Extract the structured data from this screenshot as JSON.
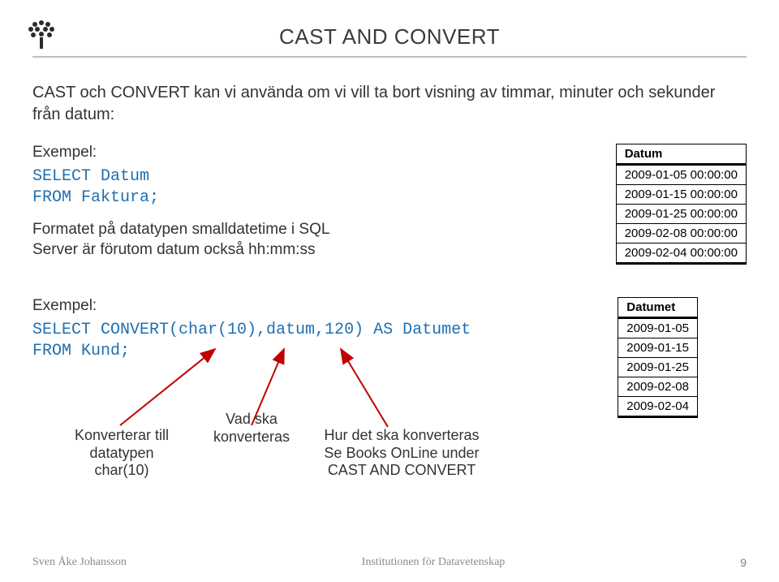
{
  "title_part1": "CAST",
  "title_small1": " AND ",
  "title_part2": "CONVERT",
  "intro": "CAST och CONVERT kan vi använda om vi vill ta bort visning av timmar, minuter och sekunder från datum:",
  "label_exempel": "Exempel:",
  "code1_line1": "SELECT Datum",
  "code1_line2": "FROM Faktura;",
  "note1_line1": "Formatet på datatypen smalldatetime i SQL",
  "note1_line2": "Server är förutom datum också hh:mm:ss",
  "table1": {
    "header": "Datum",
    "rows": [
      "2009-01-05 00:00:00",
      "2009-01-15 00:00:00",
      "2009-01-25 00:00:00",
      "2009-02-08 00:00:00",
      "2009-02-04 00:00:00"
    ]
  },
  "code2_line1": "SELECT CONVERT(char(10),datum,120) AS Datumet",
  "code2_line2": "FROM Kund;",
  "ann1_l1": "Konverterar till",
  "ann1_l2": "datatypen",
  "ann1_l3": "char(10)",
  "ann2_l1": "Vad ska",
  "ann2_l2": "konverteras",
  "ann3_l1": "Hur det ska konverteras",
  "ann3_l2": "Se Books OnLine under",
  "ann3_l3": "CAST AND CONVERT",
  "table2": {
    "header": "Datumet",
    "rows": [
      "2009-01-05",
      "2009-01-15",
      "2009-01-25",
      "2009-02-08",
      "2009-02-04"
    ]
  },
  "footer": {
    "author": "Sven Åke Johansson",
    "inst": "Institutionen för Datavetenskap",
    "page": "9"
  },
  "colors": {
    "code": "#1f6fb2",
    "arrow": "#c00000"
  }
}
